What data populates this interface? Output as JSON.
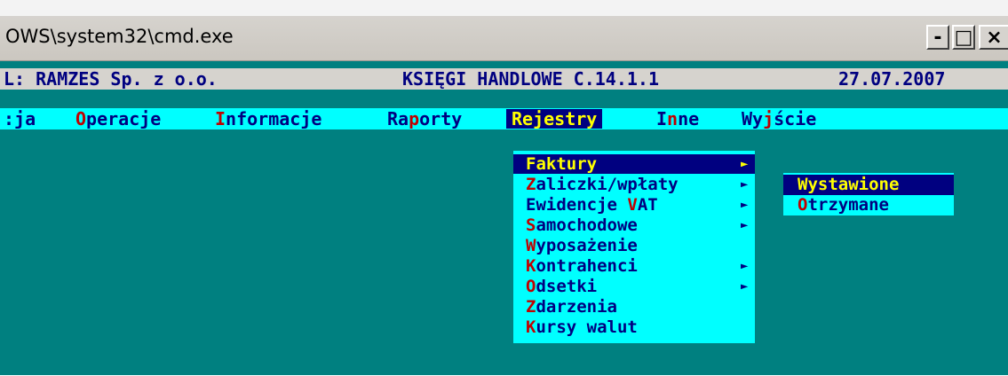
{
  "window": {
    "title": "OWS\\system32\\cmd.exe",
    "controls": {
      "minimize": "-",
      "maximize": "□",
      "close": "×"
    }
  },
  "header": {
    "company": "L: RAMZES Sp. z o.o.",
    "product": "KSIĘGI HANDLOWE C.14.1.1",
    "date": "27.07.2007"
  },
  "menubar": {
    "items": [
      {
        "pre": ":ja",
        "hk": "",
        "post": ""
      },
      {
        "pre": "",
        "hk": "O",
        "post": "peracje"
      },
      {
        "pre": "",
        "hk": "I",
        "post": "nformacje"
      },
      {
        "pre": "Ra",
        "hk": "p",
        "post": "orty"
      },
      {
        "pre": "",
        "hk": "R",
        "post": "ejestry"
      },
      {
        "pre": "I",
        "hk": "n",
        "post": "ne"
      },
      {
        "pre": "Wy",
        "hk": "j",
        "post": "ście"
      }
    ],
    "active": "Rejestry"
  },
  "dropdown": {
    "items": [
      {
        "hk": "F",
        "post": "aktury",
        "arrow": "►"
      },
      {
        "hk": "Z",
        "post": "aliczki/wpłaty",
        "arrow": "►"
      },
      {
        "pre": "Ewidencje ",
        "hk": "V",
        "post": "AT",
        "arrow": "►"
      },
      {
        "hk": "S",
        "post": "amochodowe",
        "arrow": "►"
      },
      {
        "hk": "W",
        "post": "yposażenie",
        "arrow": ""
      },
      {
        "hk": "K",
        "post": "ontrahenci",
        "arrow": "►"
      },
      {
        "hk": "O",
        "post": "dsetki",
        "arrow": "►"
      },
      {
        "hk": "Z",
        "post": "darzenia",
        "arrow": ""
      },
      {
        "hk": "K",
        "post": "ursy walut",
        "arrow": ""
      }
    ],
    "selected": "Faktury"
  },
  "submenu": {
    "items": [
      {
        "hk": "W",
        "post": "ystawione"
      },
      {
        "hk": "O",
        "post": "trzymane"
      }
    ],
    "selected": "Wystawione"
  },
  "colors": {
    "console_bg": "#008080",
    "menu_bg": "#00ffff",
    "text": "#000080",
    "hotkey": "#c00000",
    "highlight_bg": "#000080",
    "highlight_text": "#ffff00"
  }
}
